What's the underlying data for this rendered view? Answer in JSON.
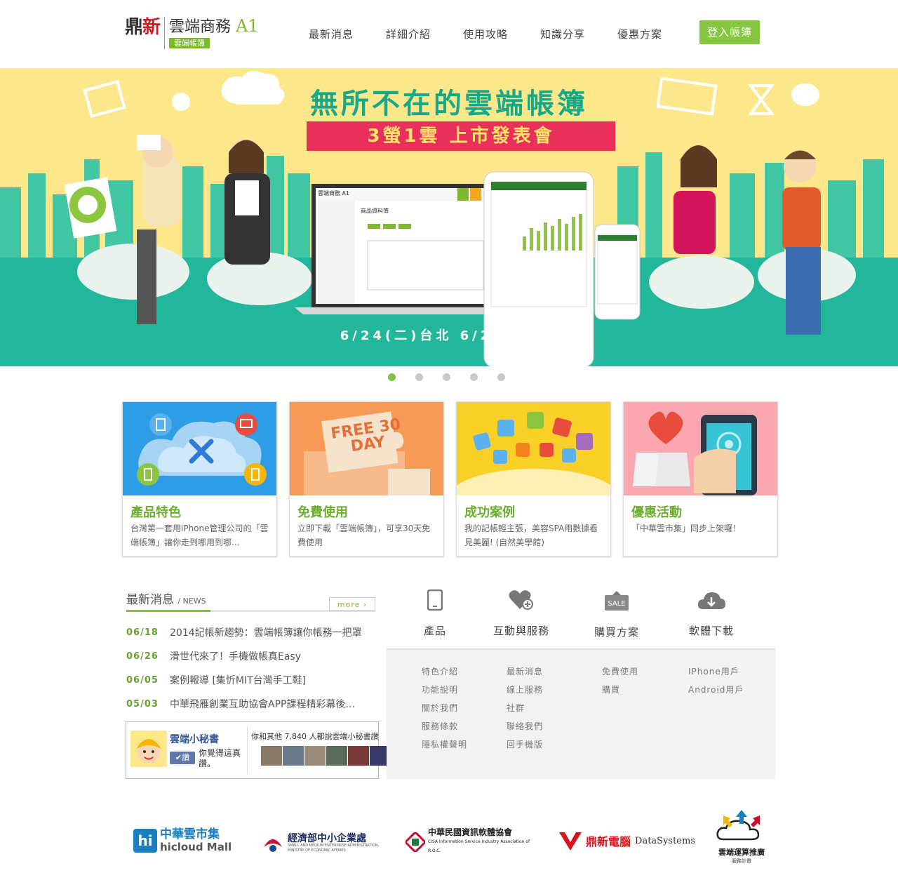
{
  "header": {
    "logo_brand_part1": "鼎",
    "logo_brand_part2": "新",
    "logo_product": "雲端商務",
    "logo_a1": "A1",
    "logo_sub": "雲端帳簿",
    "nav": [
      "最新消息",
      "詳細介紹",
      "使用攻略",
      "知識分享",
      "優惠方案"
    ],
    "login": "登入帳簿"
  },
  "banner": {
    "title": "無所不在的雲端帳簿",
    "ribbon": "3螢1雲 上市發表會",
    "dates": "6/24(二)台北  6/26(四)台中",
    "screen_title": "商品資料簿",
    "screen_brand": "雲端商務 A1"
  },
  "carousel": {
    "count": 5,
    "active": 0
  },
  "cards": [
    {
      "title": "產品特色",
      "desc": "台灣第一套用iPhone管理公司的「雲端帳簿」讓你走到哪用到哪..."
    },
    {
      "title": "免費使用",
      "desc": "立即下載「雲端帳簿」，可享30天免費使用",
      "badge": "FREE 30 DAY"
    },
    {
      "title": "成功案例",
      "desc": "我的記帳輕主張，美容SPA用數據看見美麗! (自然美學館)"
    },
    {
      "title": "優惠活動",
      "desc": "「中華雲市集」同步上架囉！"
    }
  ],
  "news": {
    "title": "最新消息",
    "subtitle": "/ NEWS",
    "more": "more ›",
    "items": [
      {
        "date": "06/18",
        "text": "2014記帳新趨勢：雲端帳簿讓你帳務一把罩"
      },
      {
        "date": "06/26",
        "text": "滑世代來了！手機做帳真Easy"
      },
      {
        "date": "06/05",
        "text": "案例報導 [集忻MIT台灣手工鞋]"
      },
      {
        "date": "05/03",
        "text": "中華飛雁創業互助協會APP課程精彩幕後..."
      }
    ]
  },
  "facebook": {
    "page_name": "雲端小秘書",
    "like_btn": "讚",
    "prompt": "你覺得這真讚。",
    "social": "你和其他 7,840 人都說雲端小秘書讚"
  },
  "links": {
    "icons": [
      {
        "label": "產品",
        "icon": "phone-icon"
      },
      {
        "label": "互動與服務",
        "icon": "heart-plus-icon"
      },
      {
        "label": "購買方案",
        "icon": "sale-tag-icon"
      },
      {
        "label": "軟體下載",
        "icon": "cloud-download-icon"
      }
    ],
    "sale_text": "SALE",
    "columns": [
      [
        "特色介紹",
        "功能說明",
        "關於我們",
        "服務條款",
        "隱私權聲明"
      ],
      [
        "最新消息",
        "線上服務",
        "社群",
        "聯絡我們",
        "回手機版"
      ],
      [
        "免費使用",
        "購買"
      ],
      [
        "IPhone用戶",
        "Android用戶"
      ]
    ]
  },
  "partners": [
    {
      "name": "中華雲市集",
      "sub": "hicloud Mall"
    },
    {
      "name": "經濟部中小企業處",
      "sub": "SMALL AND MEDIUM ENTERPRISE ADMINISTRATION, MINISTRY OF ECONOMIC AFFAIRS"
    },
    {
      "name": "中華民國資訊軟體協會",
      "sub": "CISA Information Service Industry Association of R.O.C."
    },
    {
      "name": "鼎新電腦",
      "sub": "DataSystems"
    },
    {
      "name": "雲端運算推廣",
      "sub": "服務計畫"
    }
  ],
  "colors": {
    "green": "#7fc241",
    "banner_yellow": "#fde78b",
    "banner_teal": "#22b69b",
    "ribbon": "#e8305a"
  }
}
